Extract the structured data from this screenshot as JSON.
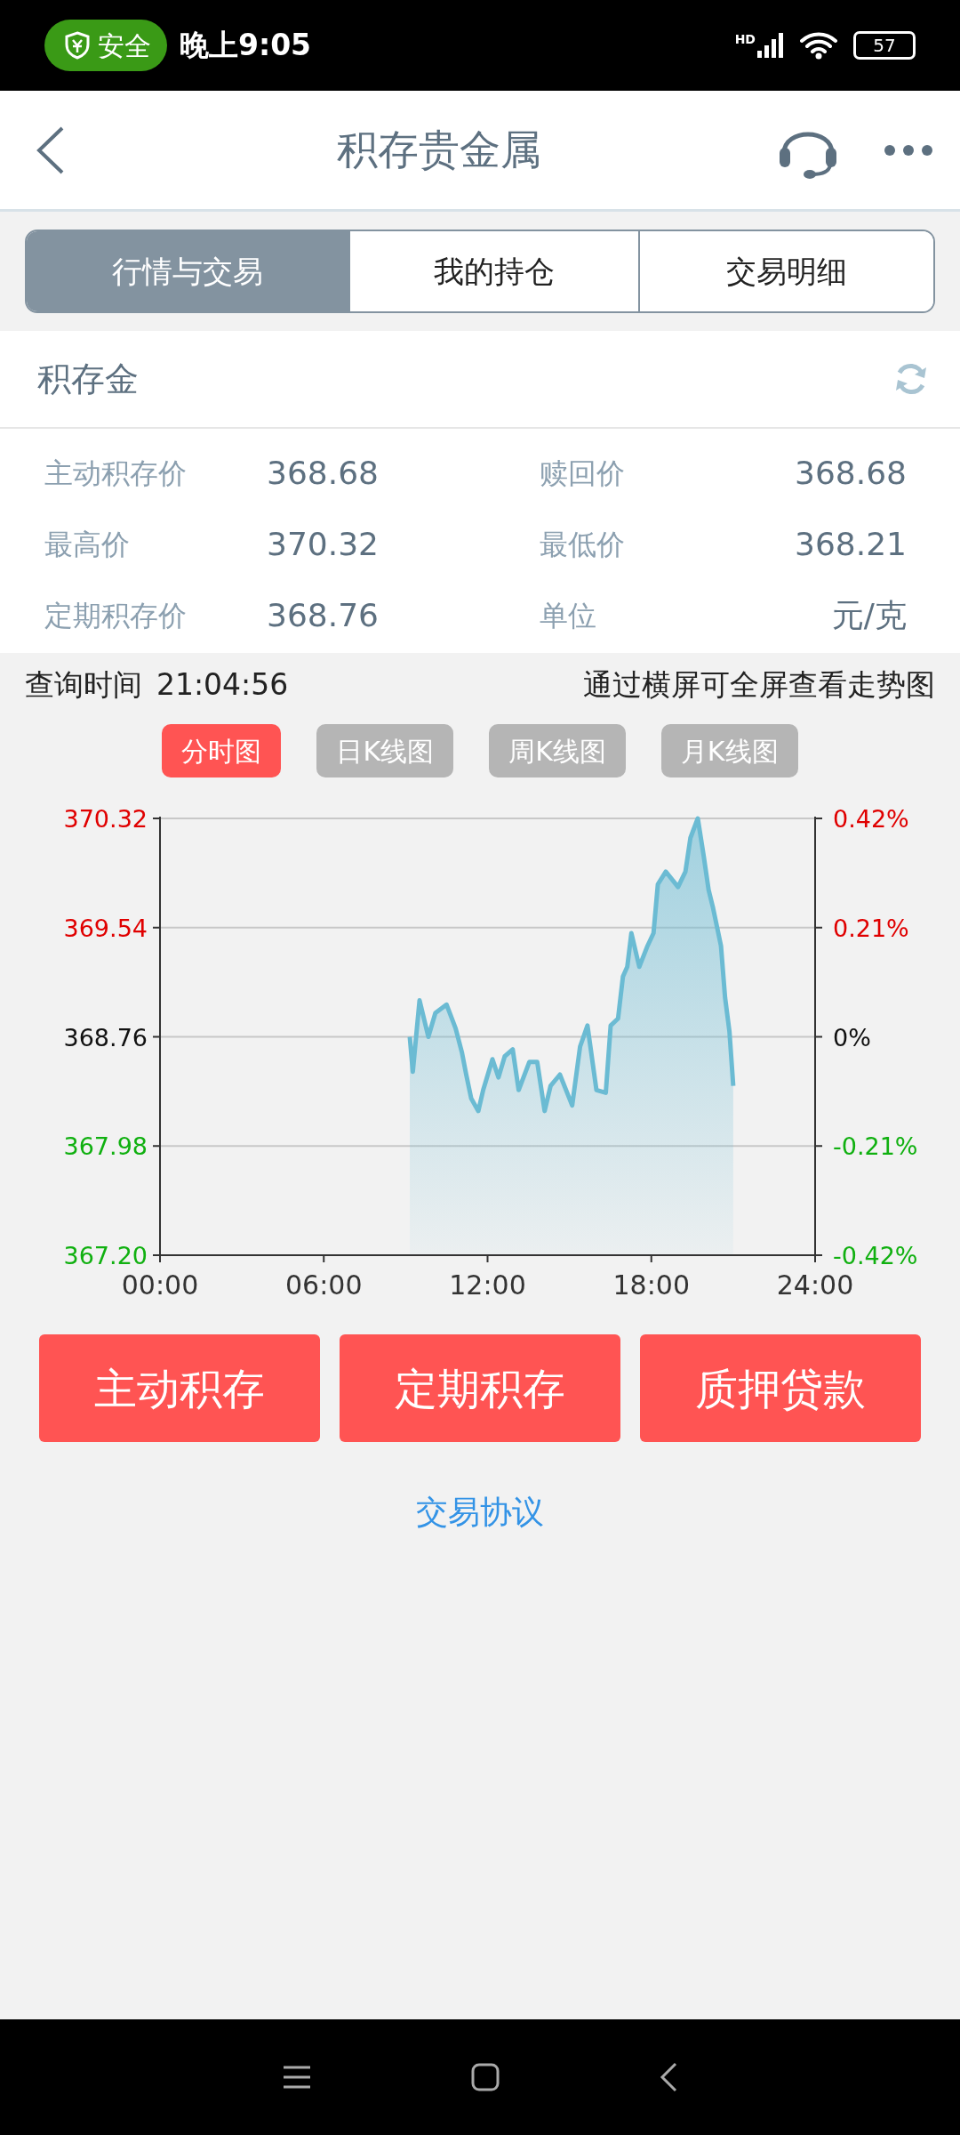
{
  "status_bar": {
    "security_badge": "安全",
    "time": "晚上9:05",
    "network_label": "HD",
    "battery": "57"
  },
  "header": {
    "title": "积存贵金属"
  },
  "tabs": [
    {
      "label": "行情与交易",
      "selected": true
    },
    {
      "label": "我的持仓",
      "selected": false
    },
    {
      "label": "交易明细",
      "selected": false
    }
  ],
  "product": {
    "title": "积存金"
  },
  "prices": [
    {
      "label": "主动积存价",
      "value": "368.68"
    },
    {
      "label": "赎回价",
      "value": "368.68"
    },
    {
      "label": "最高价",
      "value": "370.32"
    },
    {
      "label": "最低价",
      "value": "368.21"
    },
    {
      "label": "定期积存价",
      "value": "368.76"
    },
    {
      "label": "单位",
      "value": "元/克"
    }
  ],
  "query": {
    "label": "查询时间",
    "time": "21:04:56",
    "hint": "通过横屏可全屏查看走势图"
  },
  "chart_tabs": [
    {
      "label": "分时图",
      "selected": true
    },
    {
      "label": "日K线图",
      "selected": false
    },
    {
      "label": "周K线图",
      "selected": false
    },
    {
      "label": "月K线图",
      "selected": false
    }
  ],
  "chart": {
    "left_label_colors": [
      {
        "color": "#10b010"
      },
      {
        "color": "#10b010"
      },
      {
        "color": "#111111"
      },
      {
        "color": "#e00000"
      },
      {
        "color": "#e00000"
      }
    ],
    "right_labels": [
      {
        "text": "0.42%",
        "color": "#e00000"
      },
      {
        "text": "0.21%",
        "color": "#e00000"
      },
      {
        "text": "0%",
        "color": "#111111"
      },
      {
        "text": "-0.21%",
        "color": "#10b010"
      },
      {
        "text": "-0.42%",
        "color": "#10b010"
      }
    ],
    "chart_data": {
      "type": "area",
      "xlim": [
        0,
        24
      ],
      "ylim": [
        367.2,
        370.32
      ],
      "xticks": [
        {
          "value": 0,
          "label": "00:00"
        },
        {
          "value": 6,
          "label": "06:00"
        },
        {
          "value": 12,
          "label": "12:00"
        },
        {
          "value": 18,
          "label": "18:00"
        },
        {
          "value": 24,
          "label": "24:00"
        }
      ],
      "yticks": [
        {
          "value": 367.2,
          "label": "367.20"
        },
        {
          "value": 367.98,
          "label": "367.98"
        },
        {
          "value": 368.76,
          "label": "368.76"
        },
        {
          "value": 369.54,
          "label": "369.54"
        },
        {
          "value": 370.32,
          "label": "370.32"
        }
      ],
      "grid": true,
      "x": [
        9.15,
        9.26,
        9.51,
        9.83,
        10.09,
        10.5,
        10.83,
        11.06,
        11.22,
        11.4,
        11.66,
        11.84,
        12.18,
        12.4,
        12.63,
        12.92,
        13.14,
        13.53,
        13.82,
        14.09,
        14.31,
        14.65,
        15.1,
        15.39,
        15.66,
        15.99,
        16.33,
        16.51,
        16.78,
        16.96,
        17.12,
        17.27,
        17.56,
        17.86,
        18.08,
        18.24,
        18.53,
        18.98,
        19.25,
        19.43,
        19.7,
        19.92,
        20.1,
        20.26,
        20.55,
        20.7,
        20.86,
        21.0
      ],
      "series": [
        {
          "color": "#6bbbd3",
          "values": [
            368.76,
            368.51,
            369.02,
            368.76,
            368.93,
            368.99,
            368.82,
            368.65,
            368.49,
            368.32,
            368.23,
            368.38,
            368.6,
            368.47,
            368.62,
            368.67,
            368.38,
            368.58,
            368.58,
            368.23,
            368.41,
            368.49,
            368.27,
            368.69,
            368.84,
            368.38,
            368.36,
            368.84,
            368.89,
            369.19,
            369.26,
            369.5,
            369.26,
            369.41,
            369.5,
            369.85,
            369.94,
            369.83,
            369.94,
            370.18,
            370.32,
            370.05,
            369.81,
            369.68,
            369.41,
            369.04,
            368.8,
            368.41
          ]
        }
      ]
    }
  },
  "actions": [
    "主动积存",
    "定期积存",
    "质押贷款"
  ],
  "agreement_link": "交易协议"
}
